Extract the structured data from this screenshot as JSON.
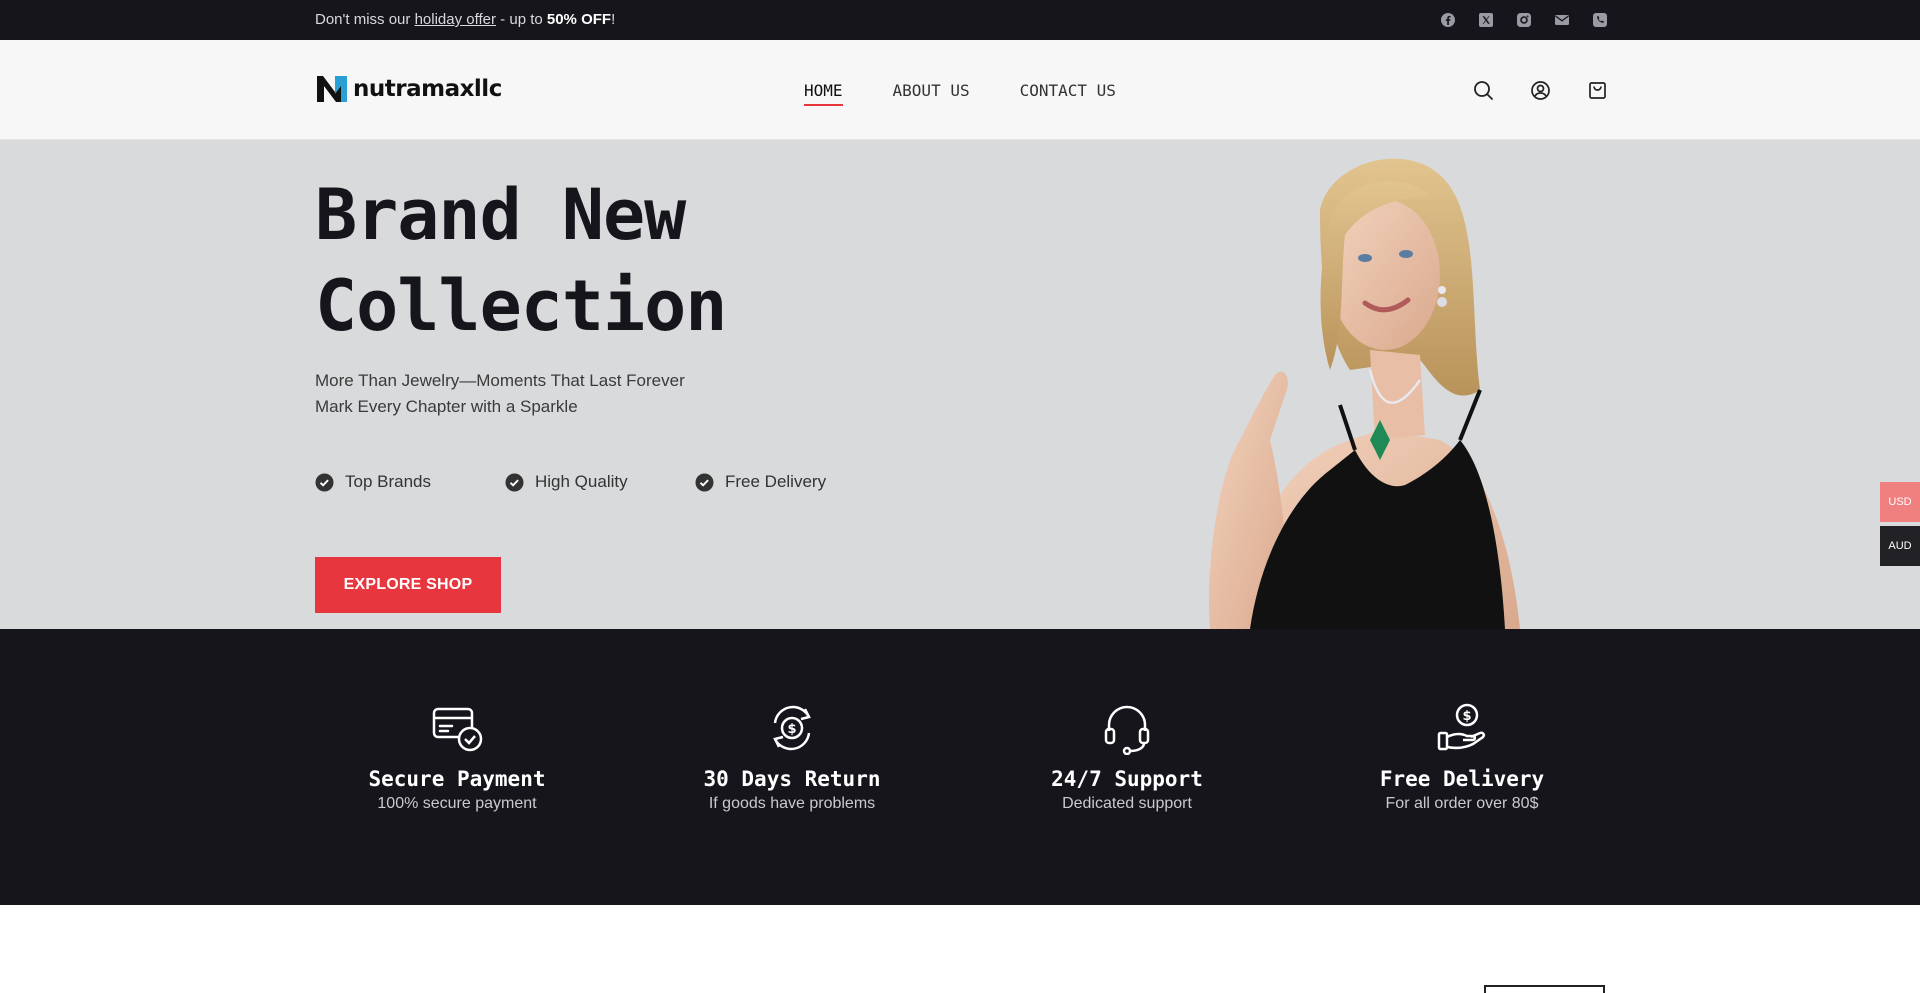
{
  "topbar": {
    "prefix": "Don't miss our ",
    "offer_link": "holiday offer",
    "middle": " - up to ",
    "discount": "50% OFF",
    "suffix": "!",
    "social_icons": [
      "facebook-icon",
      "x-twitter-icon",
      "instagram-icon",
      "email-icon",
      "phone-icon"
    ]
  },
  "header": {
    "logo_text": "nutramaxllc",
    "nav": [
      {
        "label": "HOME",
        "active": true
      },
      {
        "label": "ABOUT US",
        "active": false
      },
      {
        "label": "CONTACT US",
        "active": false
      }
    ],
    "icons": [
      "search-icon",
      "account-icon",
      "cart-icon"
    ]
  },
  "hero": {
    "title_line1": "Brand New",
    "title_line2": "Collection",
    "subtitle_line1": "More Than Jewelry—Moments That Last Forever",
    "subtitle_line2": "Mark Every Chapter with a Sparkle",
    "features": [
      "Top Brands",
      "High Quality",
      "Free Delivery"
    ],
    "cta": "EXPLORE SHOP"
  },
  "currency": {
    "usd": "USD",
    "aud": "AUD"
  },
  "services": [
    {
      "icon": "credit-card-check-icon",
      "title": "Secure Payment",
      "desc": "100% secure payment"
    },
    {
      "icon": "dollar-refresh-icon",
      "title": "30 Days Return",
      "desc": "If goods have problems"
    },
    {
      "icon": "headset-icon",
      "title": "24/7 Support",
      "desc": "Dedicated support"
    },
    {
      "icon": "hand-coin-icon",
      "title": "Free Delivery",
      "desc": "For all order over 80$"
    }
  ],
  "colors": {
    "accent": "#e8363f",
    "dark": "#15151b",
    "hero_bg": "#d9dadc",
    "usd_tab": "#f07f80"
  }
}
